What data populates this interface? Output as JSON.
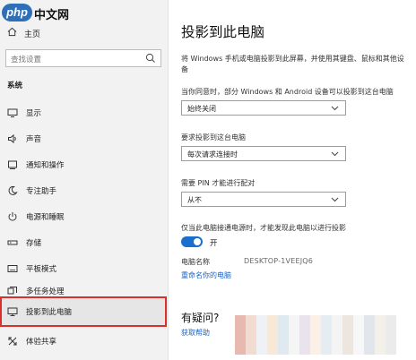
{
  "logo": {
    "badge": "php",
    "text": "中文网"
  },
  "sidebar": {
    "home_label": "主页",
    "search_placeholder": "查找设置",
    "section_title": "系统",
    "items": [
      {
        "label": "显示",
        "icon": "display-icon"
      },
      {
        "label": "声音",
        "icon": "speaker-icon"
      },
      {
        "label": "通知和操作",
        "icon": "notification-icon"
      },
      {
        "label": "专注助手",
        "icon": "moon-icon"
      },
      {
        "label": "电源和睡眠",
        "icon": "power-icon"
      },
      {
        "label": "存储",
        "icon": "storage-icon"
      },
      {
        "label": "平板模式",
        "icon": "tablet-icon"
      },
      {
        "label": "多任务处理",
        "icon": "multitask-icon"
      },
      {
        "label": "投影到此电脑",
        "icon": "project-icon",
        "selected": true
      },
      {
        "label": "体验共享",
        "icon": "share-icon"
      }
    ]
  },
  "main": {
    "title": "投影到此电脑",
    "description": "将 Windows 手机或电脑投影到此屏幕，并使用其键盘、鼠标和其他设备",
    "when_label": "当你同意时，部分 Windows 和 Android 设备可以投影到这台电脑",
    "when_value": "始终关闭",
    "ask_label": "要求投影到这台电脑",
    "ask_value": "每次请求连接时",
    "pin_label": "需要 PIN 才能进行配对",
    "pin_value": "从不",
    "power_label": "仅当此电脑接通电源时，才能发现此电脑以进行投影",
    "toggle_state": "开",
    "toggle_on": true,
    "pc_name_key": "电脑名称",
    "pc_name_value": "DESKTOP-1VEEJQ6",
    "rename_link": "重命名你的电脑",
    "help_title": "有疑问?",
    "help_link": "获取帮助"
  },
  "colors": {
    "accent": "#1a6fce",
    "link": "#1a62c4",
    "selection_outline": "#d9302c",
    "sidebar_bg": "#f2f2f2"
  }
}
